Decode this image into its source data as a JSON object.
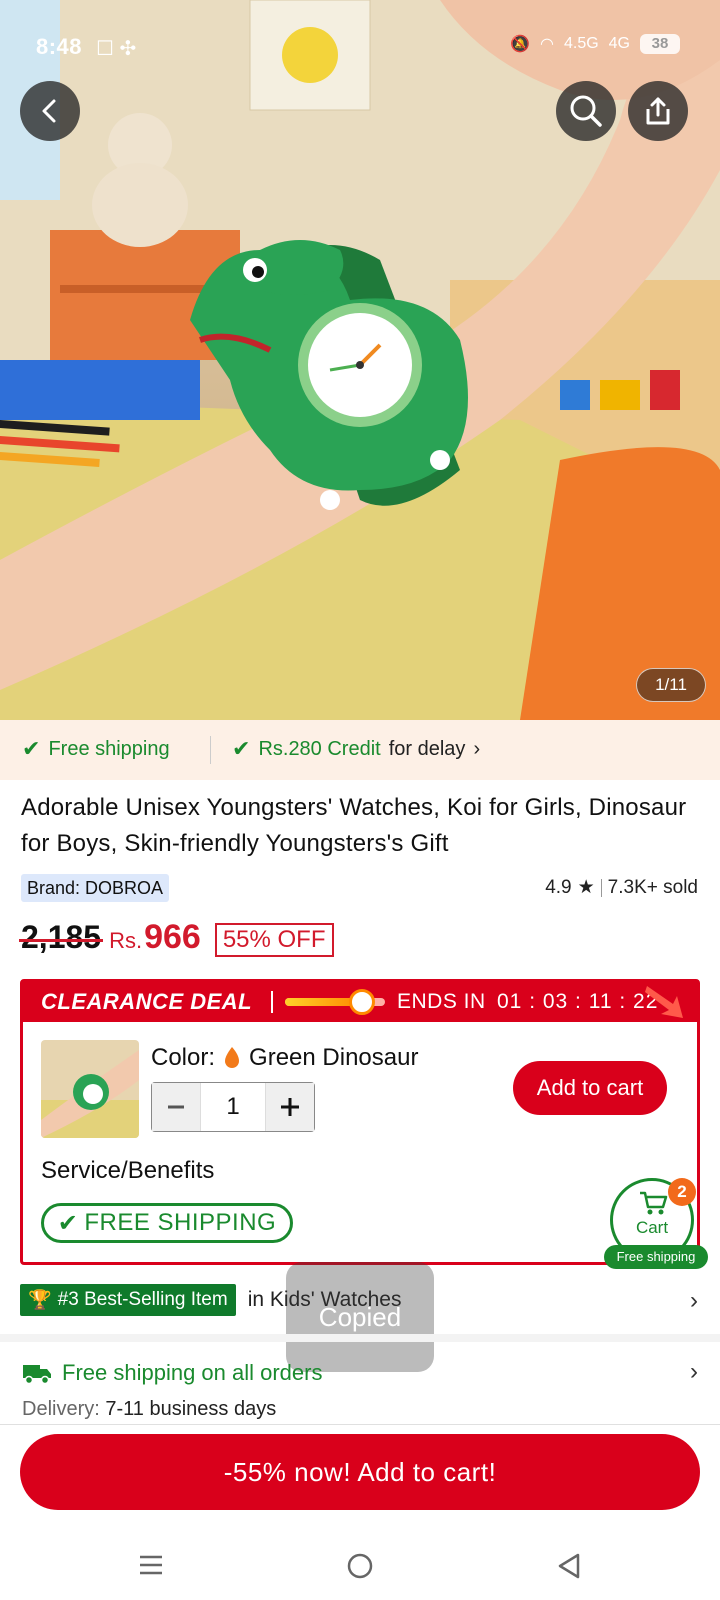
{
  "status_bar": {
    "time": "8:48",
    "network": "4.5G",
    "network2": "4G",
    "battery": "38"
  },
  "hero": {
    "image_counter": "1/11"
  },
  "shipping_strip": {
    "free_shipping": "Free shipping",
    "credit": "Rs.280 Credit",
    "credit_suffix": "for delay"
  },
  "product": {
    "title": "Adorable Unisex Youngsters' Watches, Koi for Girls, Dinosaur for Boys, Skin-friendly Youngsters's Gift",
    "brand": "Brand: DOBROA",
    "rating": "4.9",
    "sold": "7.3K+ sold",
    "original_price": "2,185",
    "currency": "Rs.",
    "price": "966",
    "discount": "55% OFF"
  },
  "deal": {
    "title": "CLEARANCE DEAL",
    "ends_label": "ENDS IN",
    "timer": "01 : 03 : 11 : 22",
    "progress": 0.75,
    "color_label": "Color:",
    "color_value": "Green Dinosaur",
    "quantity": "1",
    "add_to_cart": "Add to cart",
    "service_label": "Service/Benefits",
    "free_shipping_badge": "FREE SHIPPING"
  },
  "floating_cart": {
    "label": "Cart",
    "count": "2",
    "free_shipping": "Free shipping"
  },
  "best_seller": {
    "badge": "#3 Best-Selling Item",
    "category": "in Kids' Watches"
  },
  "toast": {
    "text": "Copied"
  },
  "shipping_info": {
    "title": "Free shipping on all orders",
    "delivery_label": "Delivery:",
    "delivery_value": "7-11 business days"
  },
  "cta": {
    "label": "-55% now! Add to cart!"
  },
  "colors": {
    "brand_red": "#d9001b",
    "green": "#1a8a2e",
    "orange": "#f26a1b"
  }
}
